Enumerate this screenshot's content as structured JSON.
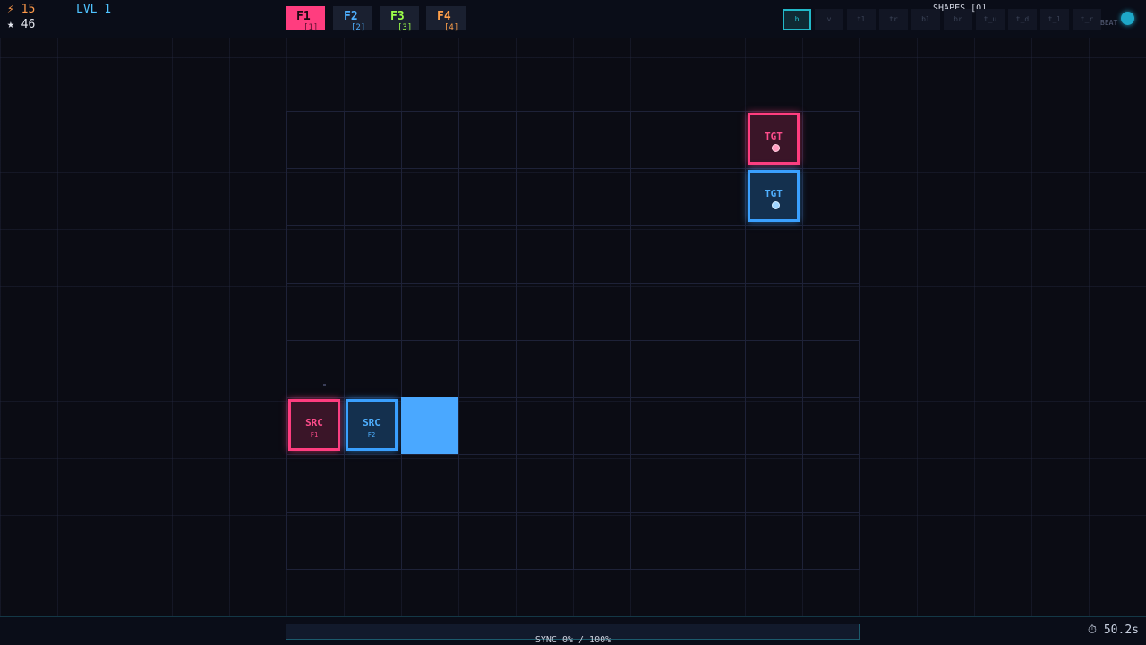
{
  "hud": {
    "energy": "⚡ 15",
    "stars": "★ 46",
    "level": "LVL 1"
  },
  "functions": [
    {
      "name": "F1",
      "key": "[1]",
      "color": "#ff3d7f",
      "active": true
    },
    {
      "name": "F2",
      "key": "[2]",
      "color": "#4fb0ff",
      "active": false
    },
    {
      "name": "F3",
      "key": "[3]",
      "color": "#9cff4a",
      "active": false
    },
    {
      "name": "F4",
      "key": "[4]",
      "color": "#ffa04a",
      "active": false
    }
  ],
  "shapes": {
    "label": "SHAPES [Q]",
    "items": [
      "h",
      "v",
      "tl",
      "tr",
      "bl",
      "br",
      "t_u",
      "t_d",
      "t_l",
      "t_r"
    ],
    "selected": "h"
  },
  "beat": {
    "label": "BEAT"
  },
  "nodes": {
    "src_pink": {
      "label": "SRC",
      "sub": "F1",
      "color": "#ff3d7f"
    },
    "src_blue": {
      "label": "SRC",
      "sub": "F2",
      "color": "#3aa0ff"
    },
    "tgt_pink": {
      "label": "TGT",
      "color": "#ff3d7f"
    },
    "tgt_blue": {
      "label": "TGT",
      "color": "#3aa0ff"
    }
  },
  "sync": {
    "text": "SYNC 0% / 100%",
    "progress": 0
  },
  "timer": "⏱ 50.2s"
}
